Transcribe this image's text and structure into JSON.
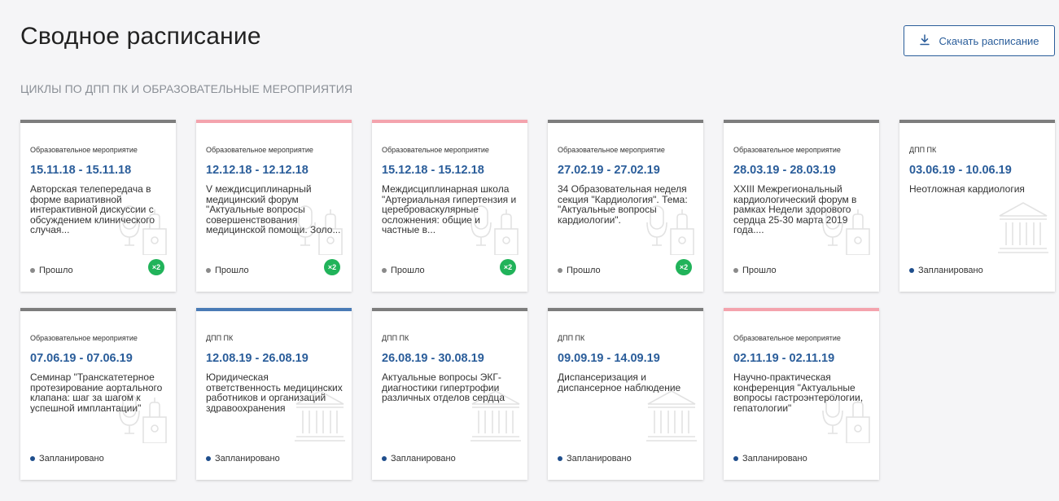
{
  "header": {
    "title": "Сводное расписание",
    "download_label": "Скачать расписание",
    "download_icon": "download-icon"
  },
  "section": {
    "title": "ЦИКЛЫ ПО ДПП ПК И ОБРАЗОВАТЕЛЬНЫЕ МЕРОПРИЯТИЯ"
  },
  "colors": {
    "accent_blue": "#2a5d9a",
    "accent_red": "#f4a3ad",
    "accent_gray": "#7d7d7d",
    "badge_green": "#21b35a"
  },
  "cards": [
    {
      "type": "Образовательное мероприятие",
      "dates": "15.11.18 - 15.11.18",
      "title": "Авторская телепередача в форме вариативной интерактивной дискуссии с обсуждением клинического случая...",
      "status": "Прошло",
      "status_kind": "past",
      "badge": "×2",
      "accent": "gray",
      "icon": "microphone-podium-icon"
    },
    {
      "type": "Образовательное мероприятие",
      "dates": "12.12.18 - 12.12.18",
      "title": "V междисциплинарный медицинский форум \"Актуальные вопросы совершенствования медицинской помощи. Золо...",
      "status": "Прошло",
      "status_kind": "past",
      "badge": "×2",
      "accent": "red",
      "icon": "microphone-podium-icon"
    },
    {
      "type": "Образовательное мероприятие",
      "dates": "15.12.18 - 15.12.18",
      "title": "Междисциплинарная школа \"Артериальная гипертензия и цереброваскулярные осложнения: общие и частные в...",
      "status": "Прошло",
      "status_kind": "past",
      "badge": "×2",
      "accent": "red",
      "icon": "microphone-podium-icon"
    },
    {
      "type": "Образовательное мероприятие",
      "dates": "27.02.19 - 27.02.19",
      "title": "34 Образовательная неделя секция \"Кардиология\". Тема: \"Актуальные вопросы кардиологии\".",
      "status": "Прошло",
      "status_kind": "past",
      "badge": "×2",
      "accent": "gray",
      "icon": "microphone-podium-icon"
    },
    {
      "type": "Образовательное мероприятие",
      "dates": "28.03.19 - 28.03.19",
      "title": "XXIII Межрегиональный кардиологический форум в рамках Недели здорового сердца 25-30 марта 2019 года....",
      "status": "Прошло",
      "status_kind": "past",
      "badge": "",
      "accent": "gray",
      "icon": "microphone-podium-icon"
    },
    {
      "type": "ДПП ПК",
      "dates": "03.06.19 - 10.06.19",
      "title": "Неотложная кардиология",
      "status": "Запланировано",
      "status_kind": "planned",
      "badge": "",
      "accent": "gray",
      "icon": "institution-icon"
    },
    {
      "type": "Образовательное мероприятие",
      "dates": "07.06.19 - 07.06.19",
      "title": "Семинар \"Транскатетерное протезирование аортального клапана: шаг за шагом к успешной имплантации\"",
      "status": "Запланировано",
      "status_kind": "planned",
      "badge": "",
      "accent": "gray",
      "icon": "microphone-podium-icon"
    },
    {
      "type": "ДПП ПК",
      "dates": "12.08.19 - 26.08.19",
      "title": "Юридическая ответственность медицинских работников и организаций здравоохранения",
      "status": "Запланировано",
      "status_kind": "planned",
      "badge": "",
      "accent": "blue",
      "icon": "institution-icon"
    },
    {
      "type": "ДПП ПК",
      "dates": "26.08.19 - 30.08.19",
      "title": "Актуальные вопросы ЭКГ-диагностики гипертрофии различных отделов сердца",
      "status": "Запланировано",
      "status_kind": "planned",
      "badge": "",
      "accent": "gray",
      "icon": "institution-icon"
    },
    {
      "type": "ДПП ПК",
      "dates": "09.09.19 - 14.09.19",
      "title": "Диспансеризация и диспансерное наблюдение",
      "status": "Запланировано",
      "status_kind": "planned",
      "badge": "",
      "accent": "gray",
      "icon": "institution-icon"
    },
    {
      "type": "Образовательное мероприятие",
      "dates": "02.11.19 - 02.11.19",
      "title": "Научно-практическая конференция \"Актуальные вопросы гастроэнтерологии, гепатологии\"",
      "status": "Запланировано",
      "status_kind": "planned",
      "badge": "",
      "accent": "red",
      "icon": "microphone-podium-icon"
    }
  ]
}
